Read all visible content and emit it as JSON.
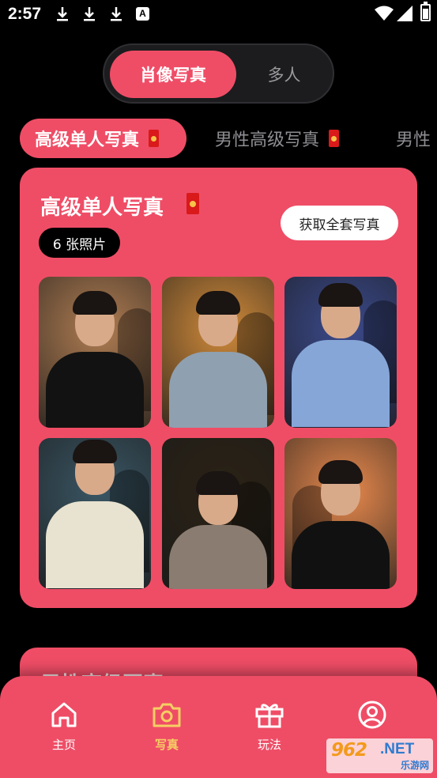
{
  "status_bar": {
    "time": "2:57",
    "a_badge": "A"
  },
  "mode_switch": {
    "options": [
      "肖像写真",
      "多人"
    ],
    "selected": "肖像写真"
  },
  "categories": {
    "items": [
      "高级单人写真",
      "男性高级写真",
      "男性"
    ],
    "selected": "高级单人写真"
  },
  "card": {
    "title": "高级单人写真",
    "photo_count": "6 张照片",
    "cta_label": "获取全套写真",
    "photos": [
      {
        "bg": "#b07d52",
        "body": "#121212"
      },
      {
        "bg": "#d08a3a",
        "body": "#8fa0b0"
      },
      {
        "bg": "#3b4a8c",
        "body": "#86a6d8"
      },
      {
        "bg": "#3a5664",
        "body": "#e8e2d0"
      },
      {
        "bg": "#2b2215",
        "body": "#8a7c70"
      },
      {
        "bg": "#e8894d",
        "body": "#111111"
      }
    ]
  },
  "next_card": {
    "title": "男性高级写真"
  },
  "bottom_nav": {
    "items": [
      "主页",
      "写真",
      "玩法",
      ""
    ],
    "selected": "写真"
  },
  "watermark": {
    "main": "962",
    "suffix": ".NET",
    "sub": "乐游网"
  },
  "colors": {
    "accent": "#ef4d66",
    "nav_active": "#f6cf63",
    "background": "#000000"
  }
}
